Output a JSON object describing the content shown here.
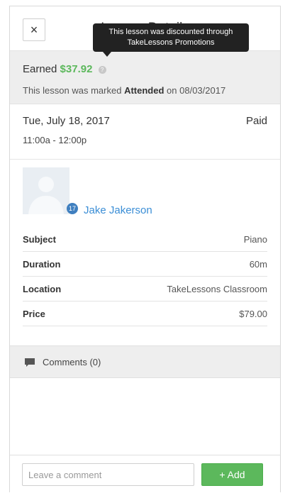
{
  "header": {
    "title": "Lesson Details",
    "close_icon": "close-icon",
    "close_glyph": "×"
  },
  "tooltip": {
    "text": "This lesson was discounted through TakeLessons Promotions"
  },
  "earnings": {
    "label": "Earned",
    "amount": "$37.92",
    "amount_color": "#5cb85c",
    "info_icon": "info-icon",
    "status_prefix": "This lesson was marked",
    "status": "Attended",
    "status_suffix": "on 08/03/2017"
  },
  "lesson": {
    "date": "Tue, July 18, 2017",
    "payment_status": "Paid",
    "time": "11:00a - 12:00p"
  },
  "student": {
    "name": "Jake Jakerson",
    "avatar_icon": "avatar-placeholder-icon",
    "badge_icon": "student-badge-icon",
    "badge_text": "17",
    "link_color": "#3b8ed6"
  },
  "details": [
    {
      "label": "Subject",
      "value": "Piano"
    },
    {
      "label": "Duration",
      "value": "60m"
    },
    {
      "label": "Location",
      "value": "TakeLessons Classroom"
    },
    {
      "label": "Price",
      "value": "$79.00"
    }
  ],
  "comments": {
    "icon": "comment-icon",
    "label": "Comments (0)"
  },
  "footer": {
    "input_placeholder": "Leave a comment",
    "input_value": "",
    "add_label": "+ Add",
    "add_color": "#5cb85c"
  }
}
